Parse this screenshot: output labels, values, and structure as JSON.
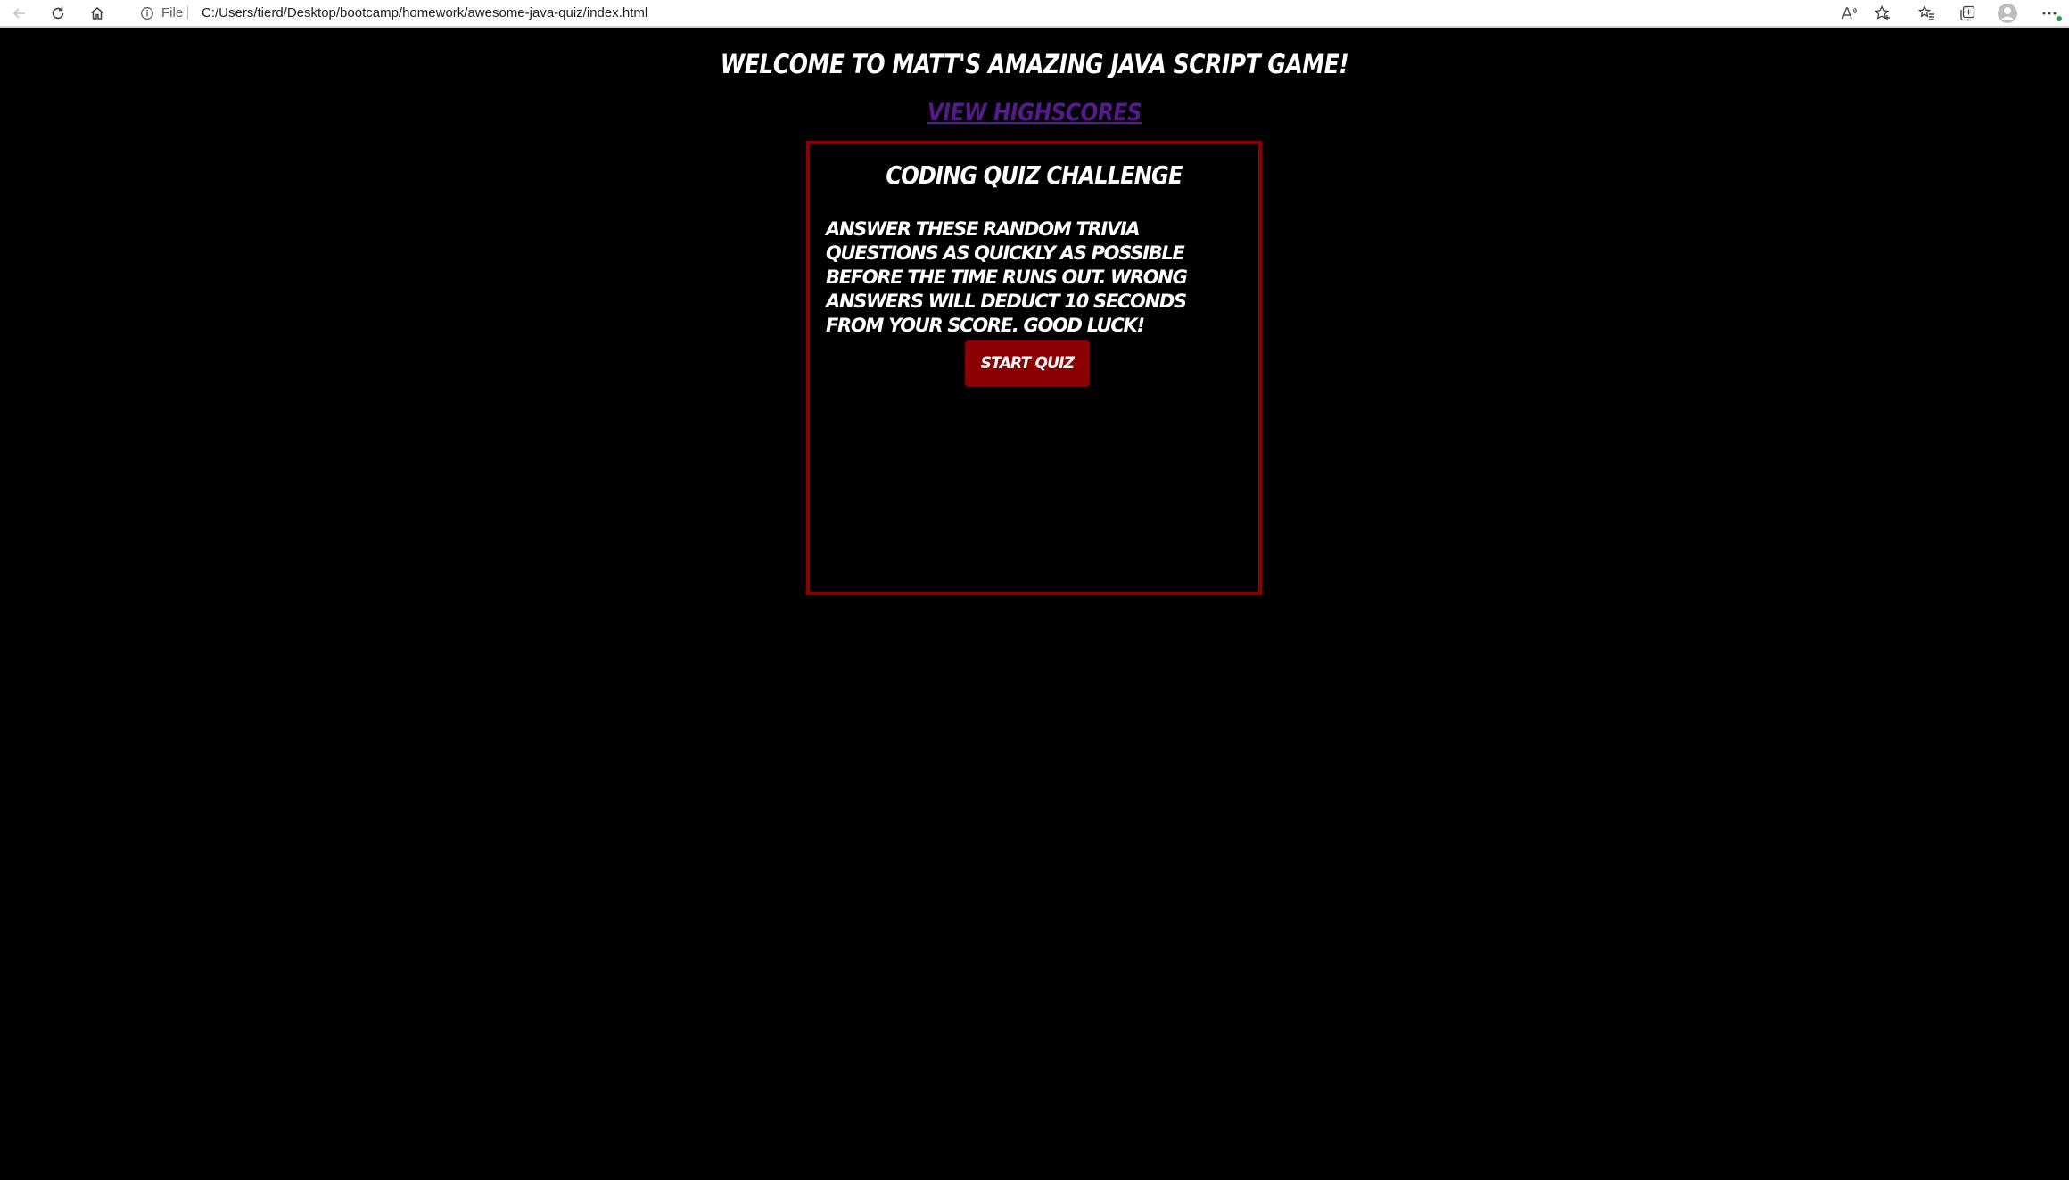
{
  "browser": {
    "address_scheme": "File",
    "address_url": "C:/Users/tierd/Desktop/bootcamp/homework/awesome-java-quiz/index.html"
  },
  "page": {
    "welcome_title": "Welcome to Matt's Amazing Java Script Game!",
    "highscores_link": "View Highscores",
    "card": {
      "title": "Coding Quiz Challenge",
      "description": "Answer these random trivia questions as quickly as possible before the time runs out. Wrong answers will deduct 10 seconds from your score. Good luck!",
      "start_button": "Start Quiz"
    }
  },
  "colors": {
    "background": "#000000",
    "text": "#ffffff",
    "accent_red": "#8b0000",
    "link_purple": "#551a8b"
  },
  "icons": [
    "back-icon",
    "refresh-icon",
    "home-icon",
    "info-icon",
    "read-aloud-icon",
    "favorite-add-icon",
    "favorites-icon",
    "collections-icon",
    "profile-icon",
    "more-icon"
  ]
}
